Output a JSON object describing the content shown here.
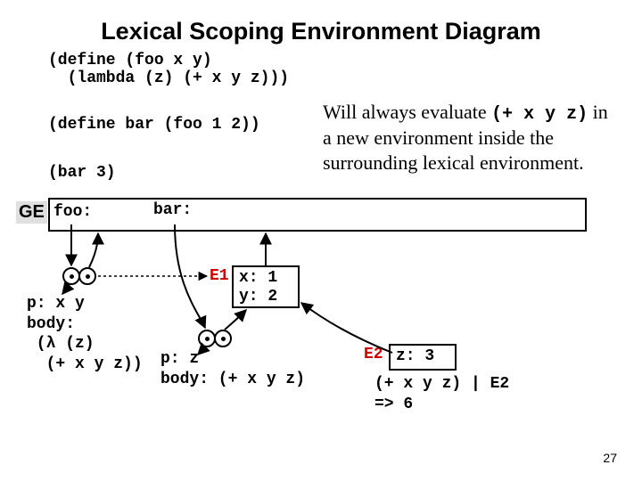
{
  "title": "Lexical Scoping Environment Diagram",
  "code": {
    "define_foo": "(define (foo x y)\n  (lambda (z) (+ x y z)))",
    "define_bar": "(define bar (foo 1 2))",
    "call_bar": "(bar 3)"
  },
  "commentary": {
    "pre_text": "Will always evaluate ",
    "inline_code": "(+ x y z)",
    "post_text": " in a new environment inside the surrounding lexical environment."
  },
  "ge": {
    "label": "GE",
    "foo": "foo:",
    "bar": "bar:"
  },
  "proc_foo": {
    "body": "p: x y\nbody:\n (λ (z)\n  (+ x y z))"
  },
  "proc_lambda": {
    "body": "p: z\nbody: (+ x y z)"
  },
  "frames": {
    "e1": {
      "label": "E1",
      "contents": "x: 1\ny: 2"
    },
    "e2": {
      "label": "E2",
      "contents": "z: 3"
    },
    "eval": "(+ x y z) | E2\n=> 6"
  },
  "page_number": "27"
}
